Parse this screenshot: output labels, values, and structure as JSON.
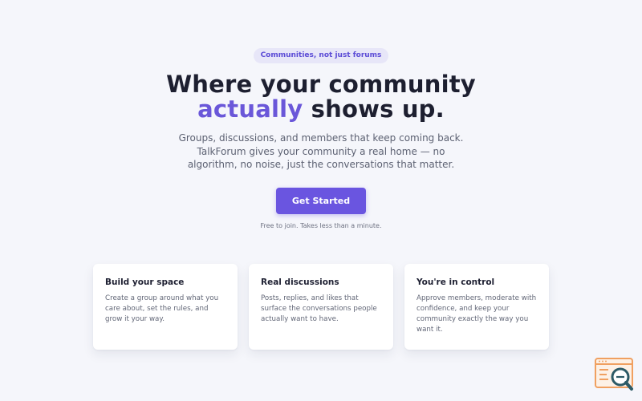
{
  "hero": {
    "badge": "Communities, not just forums",
    "headline_line1": "Where your community",
    "headline_accent": "actually",
    "headline_rest": " shows up.",
    "subtitle": "Groups, discussions, and members that keep coming back. TalkForum gives your community a real home — no algorithm, no noise, just the conversations that matter.",
    "cta_label": "Get Started",
    "note": "Free to join. Takes less than a minute."
  },
  "features": [
    {
      "title": "Build your space",
      "body": "Create a group around what you care about, set the rules, and grow it your way."
    },
    {
      "title": "Real discussions",
      "body": "Posts, replies, and likes that surface the conversations people actually want to have."
    },
    {
      "title": "You're in control",
      "body": "Approve members, moderate with confidence, and keep your community exactly the way you want it."
    }
  ],
  "colors": {
    "accent": "#6a55e0",
    "background": "#f5f6fb",
    "badge_bg": "#e7e6f8",
    "logo_orange": "#f0a060",
    "logo_teal": "#2c5a66"
  },
  "icons": {
    "corner_logo": "magnifier-over-browser-logo"
  }
}
